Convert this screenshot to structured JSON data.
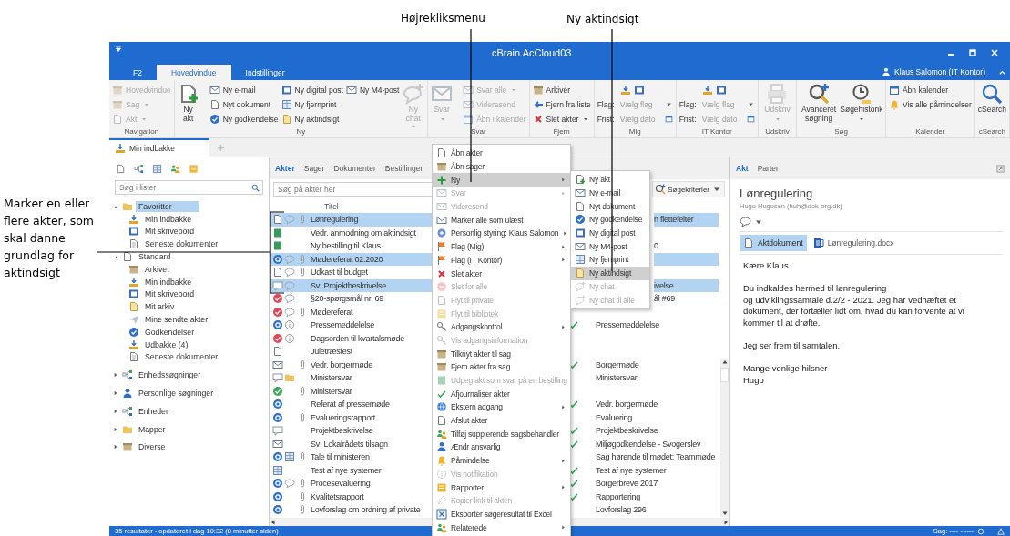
{
  "annotations": [
    {
      "text": "Højrekliksmenu"
    },
    {
      "text": "Ny aktindsigt"
    },
    {
      "text": "Marker en eller flere akter, som skal danne grundlag for aktindsigt"
    }
  ],
  "window": {
    "title": "cBrain AcCloud03",
    "user": "Klaus Salomon (IT Kontor)"
  },
  "ribbon_tabs": [
    {
      "label": "F2",
      "selected": false
    },
    {
      "label": "Hovedvindue",
      "selected": true
    },
    {
      "label": "Indstillinger",
      "selected": false
    }
  ],
  "ribbon": [
    {
      "label": "Navigation",
      "columns": [
        {
          "kind": "small",
          "items": [
            {
              "label": "Hovedvindue",
              "disabled": true,
              "dropdown": false
            },
            {
              "label": "Sag",
              "disabled": true,
              "dropdown": true
            },
            {
              "label": "Akt",
              "disabled": true,
              "dropdown": true
            }
          ]
        }
      ]
    },
    {
      "label": "Ny",
      "columns": [
        {
          "kind": "large",
          "items": [
            {
              "label": "Ny akt",
              "disabled": false,
              "dropdown": false
            }
          ]
        },
        {
          "kind": "small",
          "items": [
            {
              "label": "Ny e-mail",
              "disabled": false,
              "dropdown": false
            },
            {
              "label": "Nyt dokument",
              "disabled": false,
              "dropdown": false
            },
            {
              "label": "Ny godkendelse",
              "disabled": false,
              "dropdown": false
            }
          ]
        },
        {
          "kind": "small",
          "items": [
            {
              "label": "Ny digital post",
              "disabled": false,
              "dropdown": false
            },
            {
              "label": "Ny fjernprint",
              "disabled": false,
              "dropdown": false
            },
            {
              "label": "Ny aktindsigt",
              "disabled": false,
              "dropdown": false
            }
          ]
        },
        {
          "kind": "small",
          "items": [
            {
              "label": "Ny M4-post",
              "disabled": false,
              "dropdown": false
            }
          ]
        },
        {
          "kind": "large",
          "items": [
            {
              "label": "Ny chat",
              "disabled": true,
              "dropdown": true
            }
          ]
        }
      ]
    },
    {
      "label": "Svar",
      "columns": [
        {
          "kind": "large",
          "items": [
            {
              "label": "Svar",
              "disabled": true,
              "dropdown": true
            }
          ]
        },
        {
          "kind": "small",
          "items": [
            {
              "label": "Svar alle",
              "disabled": true,
              "dropdown": true
            },
            {
              "label": "Videresend",
              "disabled": true,
              "dropdown": false
            },
            {
              "label": "Åbn i kalender",
              "disabled": true,
              "dropdown": false
            }
          ]
        }
      ]
    },
    {
      "label": "Fjern",
      "columns": [
        {
          "kind": "small",
          "items": [
            {
              "label": "Arkivér",
              "disabled": false,
              "dropdown": false
            },
            {
              "label": "Fjern fra liste",
              "disabled": false,
              "dropdown": false
            },
            {
              "label": "Slet akter",
              "disabled": false,
              "dropdown": true
            }
          ]
        }
      ]
    },
    {
      "label": "Mig",
      "columns": [
        {
          "kind": "fields",
          "items": [
            {
              "label": "Flag:",
              "value": "Vælg flag"
            },
            {
              "label": "Frist:",
              "value": "Vælg dato"
            }
          ]
        }
      ]
    },
    {
      "label": "IT Kontor",
      "columns": [
        {
          "kind": "fields",
          "items": [
            {
              "label": "Flag:",
              "value": "Vælg flag"
            },
            {
              "label": "Frist:",
              "value": "Vælg dato"
            }
          ]
        }
      ]
    },
    {
      "label": "Udskriv",
      "columns": [
        {
          "kind": "large",
          "items": [
            {
              "label": "Udskriv",
              "disabled": true,
              "dropdown": true
            }
          ]
        }
      ]
    },
    {
      "label": "Søg",
      "columns": [
        {
          "kind": "large",
          "items": [
            {
              "label": "Avanceret søgning",
              "disabled": false,
              "dropdown": false
            }
          ]
        },
        {
          "kind": "large",
          "items": [
            {
              "label": "Søgehistorik",
              "disabled": false,
              "dropdown": true
            }
          ]
        }
      ]
    },
    {
      "label": "Kalender",
      "columns": [
        {
          "kind": "small",
          "items": [
            {
              "label": "Åbn kalender",
              "disabled": false,
              "dropdown": false
            },
            {
              "label": "Vis alle påmindelser",
              "disabled": false,
              "dropdown": false
            }
          ]
        }
      ]
    },
    {
      "label": "cSearch",
      "columns": [
        {
          "kind": "large",
          "items": [
            {
              "label": "cSearch",
              "disabled": false,
              "dropdown": false
            }
          ]
        }
      ]
    }
  ],
  "doc_tabs": [
    {
      "label": "Min indbakke",
      "selected": true
    }
  ],
  "sidebar": {
    "search": {
      "placeholder": "Søg i lister"
    },
    "tree": [
      {
        "label": "Favoritter",
        "expanded": true,
        "selected": true,
        "children": [
          {
            "label": "Min indbakke",
            "selected": false
          },
          {
            "label": "Mit skrivebord",
            "selected": false
          },
          {
            "label": "Seneste dokumenter",
            "selected": false
          }
        ]
      },
      {
        "label": "Standard",
        "expanded": true,
        "selected": false,
        "children": [
          {
            "label": "Arkivet",
            "selected": false
          },
          {
            "label": "Min indbakke",
            "selected": false
          },
          {
            "label": "Mit skrivebord",
            "selected": false
          },
          {
            "label": "Mit arkiv",
            "selected": false
          },
          {
            "label": "Mine sendte akter",
            "selected": false
          },
          {
            "label": "Godkendelser",
            "selected": false
          },
          {
            "label": "Udbakke (4)",
            "selected": false
          },
          {
            "label": "Seneste dokumenter",
            "selected": false
          }
        ]
      },
      {
        "label": "Enhedssøgninger",
        "expanded": false,
        "selected": false
      },
      {
        "label": "Personlige søgninger",
        "expanded": false,
        "selected": false
      },
      {
        "label": "Enheder",
        "expanded": false,
        "selected": false
      },
      {
        "label": "Mapper",
        "expanded": false,
        "selected": false
      },
      {
        "label": "Diverse",
        "expanded": false,
        "selected": false
      }
    ]
  },
  "list": {
    "tabs": [
      {
        "label": "Akter",
        "selected": true
      },
      {
        "label": "Sager",
        "selected": false
      },
      {
        "label": "Dokumenter",
        "selected": false
      },
      {
        "label": "Bestillinger",
        "selected": false
      }
    ],
    "search": {
      "placeholder": "Søg på akter her"
    },
    "criteria_button": "Søgekriterier",
    "columns": [
      {
        "label": "Titel"
      }
    ],
    "rows": [
      {
        "title": "Lønregulering",
        "selected": true,
        "attachment": true,
        "column_3": "n flettefelter"
      },
      {
        "title": "Vedr. anmodning om aktindsigt",
        "selected": false,
        "attachment": false
      },
      {
        "title": "Ny bestilling til Klaus",
        "selected": false,
        "attachment": false,
        "column_3": "0"
      },
      {
        "title": "Mødereferat 02.2020",
        "selected": true,
        "attachment": true
      },
      {
        "title": "Udkast til budget",
        "selected": false,
        "attachment": true
      },
      {
        "title": "Sv: Projektbeskrivelse",
        "selected": true,
        "attachment": false,
        "column_3": "ivelse"
      },
      {
        "title": "§20-spørgsmål nr. 69",
        "selected": false,
        "attachment": false,
        "column_3": "ål #69"
      },
      {
        "title": "Mødereferat",
        "selected": false,
        "attachment": true,
        "checked": false
      },
      {
        "title": "Pressemeddelelse",
        "selected": false,
        "attachment": false,
        "checked": true,
        "column_3": "Pressemeddelelse"
      },
      {
        "title": "Dagsorden til kvartalsmøde",
        "selected": false,
        "attachment": false,
        "checked": false
      },
      {
        "title": "Juletræsfest",
        "selected": false,
        "attachment": false,
        "checked": false
      },
      {
        "title": "Vedr. borgermøde",
        "selected": false,
        "attachment": true,
        "checked": true,
        "column_3": "Borgermøde"
      },
      {
        "title": "Ministersvar",
        "selected": false,
        "attachment": false,
        "checked": false,
        "column_3": "Ministersvar"
      },
      {
        "title": "Ministersvar",
        "selected": false,
        "attachment": true,
        "checked": false
      },
      {
        "title": "Referat af pressemøde",
        "selected": false,
        "attachment": false,
        "checked": true,
        "column_3": "Vedr. borgermøde"
      },
      {
        "title": "Evalueringsrapport",
        "selected": false,
        "attachment": true,
        "checked": false,
        "column_3": "Evaluering"
      },
      {
        "title": "Projektbeskrivelse",
        "selected": false,
        "attachment": false,
        "checked": true,
        "column_3": "Projektbeskrivelse"
      },
      {
        "title": "Sv: Lokalrådets tilsagn",
        "selected": false,
        "attachment": false,
        "checked": true,
        "column_3": "Miljøgodkendelse - Svogerslev"
      },
      {
        "title": "Tale til ministeren",
        "selected": false,
        "attachment": true,
        "checked": false,
        "column_3": "Sag hørende til mødet: Teammøde"
      },
      {
        "title": "Test af nye systemer",
        "selected": false,
        "attachment": false,
        "checked": true,
        "column_3": "Test af nye systemer"
      },
      {
        "title": "Procesevaluering",
        "selected": false,
        "attachment": true,
        "checked": true,
        "column_3": "Borgerbreve 2017"
      },
      {
        "title": "Kvalitetsrapport",
        "selected": false,
        "attachment": true,
        "checked": true,
        "column_3": "Rapportering"
      },
      {
        "title": "Lovforslag om ordning af private",
        "selected": false,
        "attachment": true,
        "checked": false,
        "column_3": "Lovforslag 296"
      }
    ]
  },
  "context_menu": [
    {
      "label": "Åbn akter",
      "disabled": false,
      "submenu": false,
      "selected": false
    },
    {
      "label": "Åbn sager",
      "disabled": false,
      "submenu": false,
      "selected": false
    },
    {
      "label": "Ny",
      "disabled": false,
      "submenu": true,
      "selected": true
    },
    {
      "label": "Svar",
      "disabled": true,
      "submenu": true,
      "selected": false
    },
    {
      "label": "Videresend",
      "disabled": true,
      "submenu": false,
      "selected": false
    },
    {
      "label": "Marker alle som ulæst",
      "disabled": false,
      "submenu": false,
      "selected": false
    },
    {
      "label": "Personlig styring: Klaus Salomon",
      "disabled": false,
      "submenu": true,
      "selected": false
    },
    {
      "label": "Flag (Mig)",
      "disabled": false,
      "submenu": true,
      "selected": false
    },
    {
      "label": "Flag (IT Kontor)",
      "disabled": false,
      "submenu": true,
      "selected": false
    },
    {
      "label": "Slet akter",
      "disabled": false,
      "submenu": false,
      "selected": false
    },
    {
      "label": "Slet for alle",
      "disabled": true,
      "submenu": false,
      "selected": false
    },
    {
      "label": "Flyt til private",
      "disabled": true,
      "submenu": false,
      "selected": false
    },
    {
      "label": "Flyt til bibliotek",
      "disabled": true,
      "submenu": false,
      "selected": false
    },
    {
      "label": "Adgangskontrol",
      "disabled": false,
      "submenu": true,
      "selected": false
    },
    {
      "label": "Vis adgangsinformation",
      "disabled": true,
      "submenu": false,
      "selected": false
    },
    {
      "label": "Tilknyt akter til sag",
      "disabled": false,
      "submenu": false,
      "selected": false
    },
    {
      "label": "Fjern akter fra sag",
      "disabled": false,
      "submenu": false,
      "selected": false
    },
    {
      "label": "Udpeg akt som svar på en bestilling",
      "disabled": true,
      "submenu": false,
      "selected": false
    },
    {
      "label": "Afjournaliser akter",
      "disabled": false,
      "submenu": false,
      "selected": false
    },
    {
      "label": "Ekstern adgang",
      "disabled": false,
      "submenu": true,
      "selected": false
    },
    {
      "label": "Afslut akter",
      "disabled": false,
      "submenu": false,
      "selected": false
    },
    {
      "label": "Tilføj supplerende sagsbehandler",
      "disabled": false,
      "submenu": false,
      "selected": false
    },
    {
      "label": "Ændr ansvarlig",
      "disabled": false,
      "submenu": false,
      "selected": false
    },
    {
      "label": "Påmindelse",
      "disabled": false,
      "submenu": true,
      "selected": false
    },
    {
      "label": "Vis notifikation",
      "disabled": true,
      "submenu": false,
      "selected": false
    },
    {
      "label": "Rapporter",
      "disabled": false,
      "submenu": true,
      "selected": false
    },
    {
      "label": "Kopier link til akten",
      "disabled": true,
      "submenu": false,
      "selected": false
    },
    {
      "label": "Eksportér søgeresultat til Excel",
      "disabled": false,
      "submenu": false,
      "selected": false
    },
    {
      "label": "Relaterede",
      "disabled": false,
      "submenu": true,
      "selected": false
    }
  ],
  "submenu": [
    {
      "label": "Ny akt",
      "disabled": false,
      "selected": false
    },
    {
      "label": "Ny e-mail",
      "disabled": false,
      "selected": false
    },
    {
      "label": "Nyt dokument",
      "disabled": false,
      "selected": false
    },
    {
      "label": "Ny godkendelse",
      "disabled": false,
      "selected": false
    },
    {
      "label": "Ny digital post",
      "disabled": false,
      "selected": false
    },
    {
      "label": "Ny M4-post",
      "disabled": false,
      "selected": false
    },
    {
      "label": "Ny fjernprint",
      "disabled": false,
      "selected": false
    },
    {
      "label": "Ny aktindsigt",
      "disabled": false,
      "selected": true
    },
    {
      "label": "Ny chat",
      "disabled": true,
      "selected": false
    },
    {
      "label": "Ny chat til alle",
      "disabled": true,
      "selected": false
    }
  ],
  "preview": {
    "tabs": [
      {
        "label": "Akt",
        "selected": true
      },
      {
        "label": "Parter",
        "selected": false
      }
    ],
    "title": "Lønregulering",
    "sender": "Hugo Hugosen (huh@dok-org.dk)",
    "attachments": [
      {
        "label": "Aktdokument",
        "selected": true
      },
      {
        "label": "Lønregulering.docx",
        "selected": false
      }
    ],
    "body": [
      [
        "Kære Klaus."
      ],
      [
        "Du indkaldes hermed til lønregulering",
        "og udviklingssamtale d.2/2 - 2021. Jeg har vedhæftet et",
        "dokument, der fortæller lidt om, hvad du kan forvente at vi",
        "kommer til at drøfte."
      ],
      [
        "Jeg ser frem til samtalen."
      ],
      [
        "Mange venlige hilsner",
        "Hugo"
      ]
    ]
  },
  "status_bar": {
    "text": "35 resultater - opdateret i dag 10:32 (8 minutter siden)",
    "case": "Sag: ---- - ----"
  }
}
